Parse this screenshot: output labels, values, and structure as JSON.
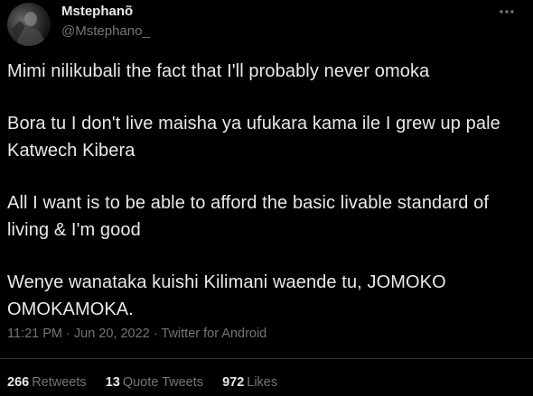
{
  "user": {
    "display_name": "Mstephanõ",
    "handle": "@Mstephano_"
  },
  "tweet": {
    "paragraphs": [
      "Mimi nilikubali the fact that I'll probably never omoka",
      "Bora tu I don't live maisha ya ufukara kama ile I grew up pale Katwech Kibera",
      "All I want is to be able to afford the basic livable standard of living & I'm good",
      "Wenye wanataka kuishi Kilimani waende tu, JOMOKO OMOKAMOKA."
    ],
    "time": "11:21 PM",
    "separator": "·",
    "date": "Jun 20, 2022",
    "source": "Twitter for Android"
  },
  "stats": {
    "retweets_count": "266",
    "retweets_label": "Retweets",
    "quotes_count": "13",
    "quotes_label": "Quote Tweets",
    "likes_count": "972",
    "likes_label": "Likes"
  },
  "icons": {
    "more": "more-horizontal-icon"
  },
  "colors": {
    "background": "#000000",
    "primary_text": "#e7e9ea",
    "secondary_text": "#71767b",
    "divider": "#2f3336"
  }
}
